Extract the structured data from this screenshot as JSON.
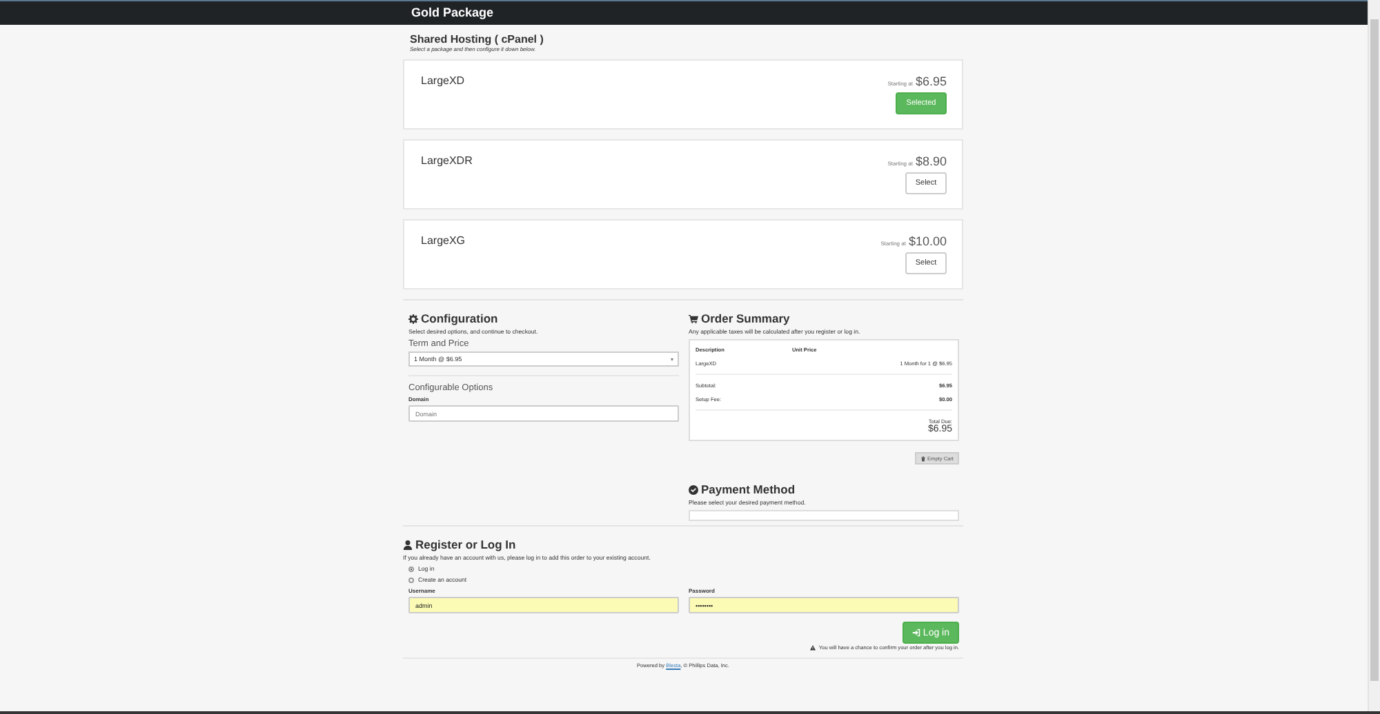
{
  "header": {
    "title": "Gold Package"
  },
  "section": {
    "title": "Shared Hosting ( cPanel )",
    "subtitle": "Select a package and then configure it down below."
  },
  "packages": [
    {
      "name": "LargeXD",
      "starting_label": "Starting at",
      "price": "$6.95",
      "button": "Selected",
      "selected": true
    },
    {
      "name": "LargeXDR",
      "starting_label": "Starting at",
      "price": "$8.90",
      "button": "Select",
      "selected": false
    },
    {
      "name": "LargeXG",
      "starting_label": "Starting at",
      "price": "$10.00",
      "button": "Select",
      "selected": false
    }
  ],
  "configuration": {
    "title": "Configuration",
    "subtitle": "Select desired options, and continue to checkout.",
    "term_label": "Term and Price",
    "term_value": "1 Month @ $6.95",
    "options_title": "Configurable Options",
    "domain_label": "Domain",
    "domain_placeholder": "Domain"
  },
  "summary": {
    "title": "Order Summary",
    "note": "Any applicable taxes will be calculated after you register or log in.",
    "columns": [
      "Description",
      "Unit Price"
    ],
    "rows": [
      {
        "description": "LargeXD",
        "price": "1 Month for 1 @ $6.95"
      }
    ],
    "lines": [
      {
        "label": "Subtotal:",
        "value": "$6.95"
      },
      {
        "label": "Setup Fee:",
        "value": "$0.00"
      }
    ],
    "total_label": "Total Due:",
    "total": "$6.95",
    "empty_cart": "Empty Cart"
  },
  "payment": {
    "title": "Payment Method",
    "note": "Please select your desired payment method."
  },
  "register": {
    "title": "Register or Log In",
    "note": "If you already have an account with us, please log in to add this order to your existing account.",
    "options": [
      {
        "label": "Log in",
        "selected": true
      },
      {
        "label": "Create an account",
        "selected": false
      }
    ],
    "username_label": "Username",
    "username": "admin",
    "password_label": "Password",
    "password": "••••••••",
    "login_button": "Log in",
    "notice": "You will have a chance to confirm your order after you log in."
  },
  "footer": {
    "prefix": "Powered by",
    "link": "Blesta",
    "suffix": ", © Phillips Data, Inc."
  }
}
